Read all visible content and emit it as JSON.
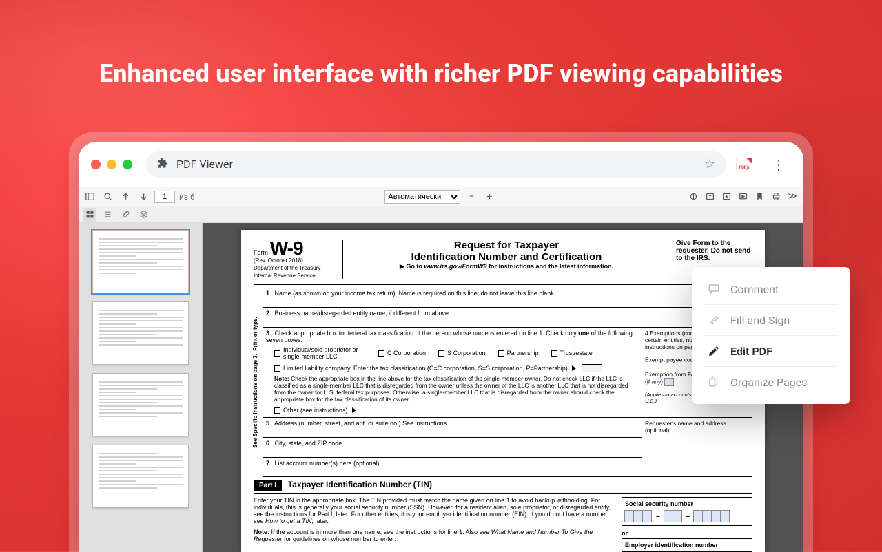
{
  "headline": "Enhanced user interface with richer PDF viewing capabilities",
  "browser": {
    "addressTitle": "PDF Viewer"
  },
  "toolbar": {
    "pageCurrent": "1",
    "pageOf": "из 6",
    "zoomSelected": "Автоматически"
  },
  "form": {
    "formWord": "Form",
    "formNo": "W-9",
    "rev": "(Rev. October 2018)",
    "dept": "Department of the Treasury",
    "irs": "Internal Revenue Service",
    "title": "Request for Taxpayer",
    "subtitle": "Identification Number and Certification",
    "linkPrefix": "▶ Go to ",
    "linkUrl": "www.irs.gov/FormW9",
    "linkSuffix": " for instructions and the latest information.",
    "giveForm": "Give Form to the requester. Do not send to the IRS.",
    "sideText": "Print or type.",
    "sideText2": "See Specific Instructions on page 3.",
    "row1": "Name (as shown on your income tax return). Name is required on this line; do not leave this line blank.",
    "row2": "Business name/disregarded entity name, if different from above",
    "row3a": "Check appropriate box for federal tax classification of the person whose name is entered on line 1. Check only ",
    "row3bold": "one",
    "row3b": " of the following seven boxes.",
    "chk": {
      "ind": "Individual/sole proprietor or single-member LLC",
      "ccorp": "C Corporation",
      "scorp": "S Corporation",
      "part": "Partnership",
      "trust": "Trust/estate",
      "llc": "Limited liability company. Enter the tax classification (C=C corporation, S=S corporation, P=Partnership)",
      "other": "Other (see instructions)"
    },
    "noteLabel": "Note:",
    "llcNote": " Check the appropriate box in the line above for the tax classification of the single-member owner.  Do not check LLC if the LLC is classified as a single-member LLC that is disregarded from the owner unless the owner of the LLC is another LLC that is not disregarded from the owner for U.S. federal tax purposes. Otherwise, a single-member LLC that is disregarded from the owner should check the appropriate box for the tax classification of its owner.",
    "exempt": {
      "head": "Exemptions (codes apply only to certain entities, not individuals; see instructions on page 3):",
      "payee": "Exempt payee code (if any)",
      "fatca": "Exemption from FATCA reporting code (if any)",
      "foot": "(Applies to accounts maintained outside the U.S.)"
    },
    "row5": "Address (number, street, and apt. or suite no.) See instructions.",
    "row5r": "Requester's name and address (optional)",
    "row6": "City, state, and ZIP code",
    "row7": "List account number(s) here (optional)",
    "part1": "Part I",
    "part1title": "Taxpayer Identification Number (TIN)",
    "tinPara": "Enter your TIN in the appropriate box. The TIN provided must match the name given on line 1 to avoid backup withholding. For individuals, this is generally your social security number (SSN). However, for a resident alien, sole proprietor, or disregarded entity, see the instructions for Part I, later. For other entities, it is your employer identification number (EIN). If you do not have a number, see ",
    "tinItalic": "How to get a TIN,",
    "tinAfter": " later.",
    "tinNote": " If the account is in more than one name, see the instructions for line 1. Also see ",
    "tinNoteItalic": "What Name and Number To Give the Requester",
    "tinNoteAfter": " for guidelines on whose number to enter.",
    "ssnLabel": "Social security number",
    "orLabel": "or",
    "einLabel": "Employer identification number"
  },
  "panel": {
    "comment": "Comment",
    "fill": "Fill and Sign",
    "edit": "Edit PDF",
    "org": "Organize Pages"
  }
}
